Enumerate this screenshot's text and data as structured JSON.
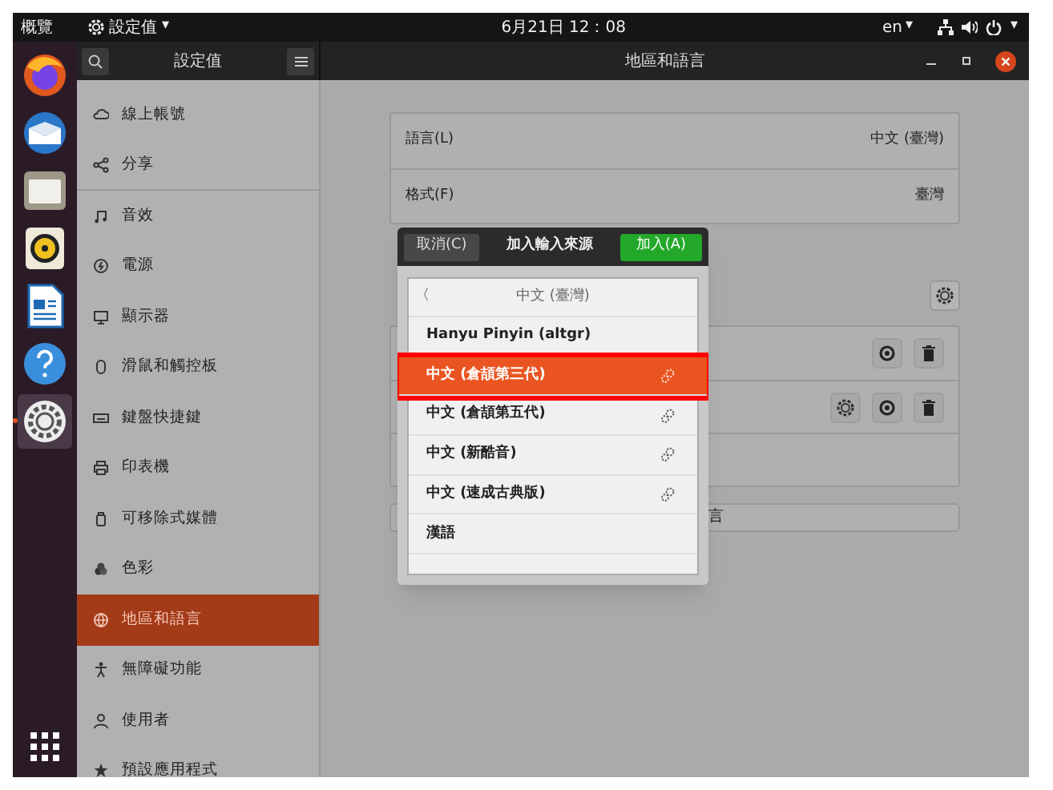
{
  "top_bar": {
    "activities": "概覽",
    "app_menu": "設定值",
    "app_menu_caret": "▾",
    "clock": "6月21日 12：08",
    "keyboard_layout": "en",
    "keyboard_caret": "▾",
    "system_caret": "▾"
  },
  "dock": {
    "apps": [
      {
        "running": false
      },
      {
        "running": false
      },
      {
        "running": false
      },
      {
        "running": false
      },
      {
        "running": false
      },
      {
        "running": false
      },
      {
        "running": true
      }
    ]
  },
  "header_bar": {
    "sidebar_title": "設定值",
    "title": "地區和語言"
  },
  "sidebar": {
    "items": [
      {
        "label": "線上帳號",
        "selected": false
      },
      {
        "label": "分享",
        "selected": false
      },
      {
        "label": "音效",
        "selected": false
      },
      {
        "label": "電源",
        "selected": false
      },
      {
        "label": "顯示器",
        "selected": false
      },
      {
        "label": "滑鼠和觸控板",
        "selected": false
      },
      {
        "label": "鍵盤快捷鍵",
        "selected": false
      },
      {
        "label": "印表機",
        "selected": false
      },
      {
        "label": "可移除式媒體",
        "selected": false
      },
      {
        "label": "色彩",
        "selected": false
      },
      {
        "label": "地區和語言",
        "selected": true
      },
      {
        "label": "無障礙功能",
        "selected": false
      },
      {
        "label": "使用者",
        "selected": false
      },
      {
        "label": "預設應用程式",
        "selected": false
      }
    ]
  },
  "settings": {
    "rows": [
      {
        "label": "語言(L)",
        "value": "中文 (臺灣)"
      },
      {
        "label": "格式(F)",
        "value": "臺灣"
      }
    ],
    "input_sources": [
      {
        "has_settings": false
      },
      {
        "has_settings": true
      },
      {
        "empty": true
      }
    ],
    "manage_button": "言"
  },
  "dialog": {
    "cancel": "取消(C)",
    "title": "加入輸入來源",
    "add": "加入(A)",
    "back": "〈",
    "heading": "中文 (臺灣)",
    "items": [
      {
        "label": "Hanyu Pinyin (altgr)",
        "selected": false,
        "has_settings": false,
        "annotated": false
      },
      {
        "label": "中文 (倉頡第三代)",
        "selected": true,
        "has_settings": true,
        "annotated": true
      },
      {
        "label": "中文 (倉頡第五代)",
        "selected": false,
        "has_settings": true,
        "annotated": false
      },
      {
        "label": "中文 (新酷音)",
        "selected": false,
        "has_settings": true,
        "annotated": false
      },
      {
        "label": "中文 (速成古典版)",
        "selected": false,
        "has_settings": true,
        "annotated": false
      },
      {
        "label": "漢語",
        "selected": false,
        "has_settings": false,
        "annotated": false
      }
    ]
  }
}
